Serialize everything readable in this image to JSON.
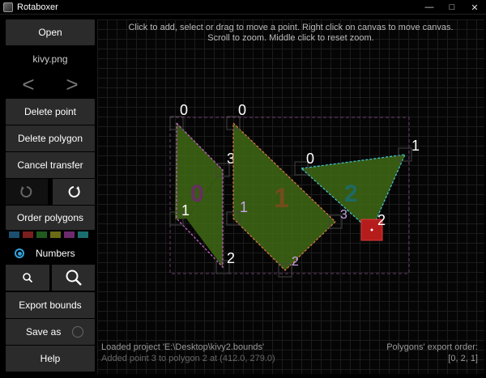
{
  "window": {
    "title": "Rotaboxer"
  },
  "sidebar": {
    "open_label": "Open",
    "filename": "kivy.png",
    "prev_symbol": "<",
    "next_symbol": ">",
    "delete_point_label": "Delete point",
    "delete_polygon_label": "Delete polygon",
    "cancel_transfer_label": "Cancel transfer",
    "order_polygons_label": "Order polygons",
    "swatch_colors": [
      "#1c4f6e",
      "#7a1e1e",
      "#1f5a1f",
      "#6a6a16",
      "#6e2a6e",
      "#1b6e6e"
    ],
    "numbers_label": "Numbers",
    "export_bounds_label": "Export bounds",
    "save_as_label": "Save as",
    "help_label": "Help"
  },
  "canvas": {
    "hint_line1": "Click to add, select or drag to move a point. Right click on canvas to move canvas.",
    "hint_line2": "Scroll to zoom. Middle click to reset zoom.",
    "polygons": [
      {
        "id": "0",
        "color": "#cc66cc",
        "points": [
          "0",
          "1",
          "2",
          "3"
        ]
      },
      {
        "id": "1",
        "color": "#e0784a",
        "points": [
          "0",
          "1",
          "2",
          "3"
        ]
      },
      {
        "id": "2",
        "color": "#44c8d8",
        "points": [
          "0",
          "1",
          "2"
        ]
      }
    ],
    "status_line1": "Loaded project 'E:\\Desktop\\kivy2.bounds'",
    "status_line2": "Added point 3 to polygon 2 at (412.0, 279.0)",
    "export_order_label": "Polygons' export order:",
    "export_order_value": "[0, 2, 1]"
  }
}
